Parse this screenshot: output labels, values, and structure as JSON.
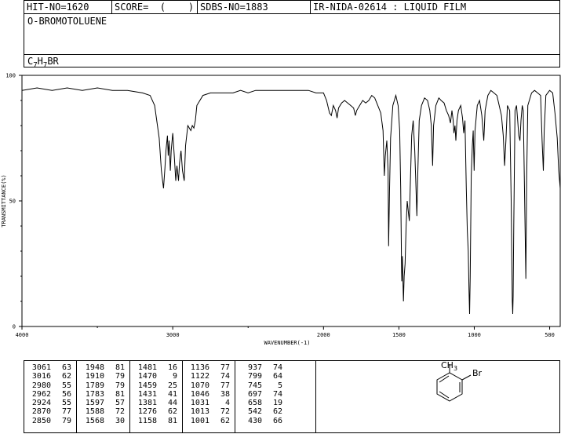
{
  "header": {
    "hit_no": "HIT-NO=1620",
    "score": "SCORE=  (    )",
    "sdbs_no": "SDBS-NO=1883",
    "ir_nida": "IR-NIDA-02614 : LIQUID FILM",
    "compound": "O-BROMOTOLUENE",
    "formula_c": "C",
    "formula_c_sub": "7",
    "formula_h": "H",
    "formula_h_sub": "7",
    "formula_br": "BR"
  },
  "chart_data": {
    "type": "line",
    "xlabel": "WAVENUMBER(-1)",
    "ylabel": "TRANSMITTANCE(%)",
    "xlim": [
      4000,
      430
    ],
    "ylim": [
      0,
      100
    ],
    "x_reversed": true,
    "x_ticks": [
      4000,
      3000,
      2000,
      1500,
      1000,
      500
    ],
    "y_ticks": [
      100,
      50,
      0
    ],
    "minor_x_ticks": [
      3500,
      2500,
      1000,
      500
    ],
    "grid": false,
    "series": [
      {
        "points": [
          [
            4000,
            94
          ],
          [
            3900,
            95
          ],
          [
            3800,
            94
          ],
          [
            3700,
            95
          ],
          [
            3600,
            94
          ],
          [
            3500,
            95
          ],
          [
            3400,
            94
          ],
          [
            3300,
            94
          ],
          [
            3200,
            93
          ],
          [
            3150,
            92
          ],
          [
            3120,
            88
          ],
          [
            3090,
            75
          ],
          [
            3075,
            62
          ],
          [
            3061,
            55
          ],
          [
            3052,
            63
          ],
          [
            3045,
            70
          ],
          [
            3035,
            76
          ],
          [
            3030,
            68
          ],
          [
            3024,
            74
          ],
          [
            3016,
            62
          ],
          [
            3010,
            70
          ],
          [
            3000,
            77
          ],
          [
            2990,
            68
          ],
          [
            2980,
            58
          ],
          [
            2972,
            64
          ],
          [
            2962,
            58
          ],
          [
            2955,
            65
          ],
          [
            2945,
            70
          ],
          [
            2935,
            62
          ],
          [
            2924,
            58
          ],
          [
            2915,
            72
          ],
          [
            2900,
            80
          ],
          [
            2880,
            78
          ],
          [
            2870,
            80
          ],
          [
            2860,
            79
          ],
          [
            2850,
            82
          ],
          [
            2840,
            88
          ],
          [
            2800,
            92
          ],
          [
            2750,
            93
          ],
          [
            2700,
            93
          ],
          [
            2650,
            93
          ],
          [
            2600,
            93
          ],
          [
            2550,
            94
          ],
          [
            2500,
            93
          ],
          [
            2450,
            94
          ],
          [
            2400,
            94
          ],
          [
            2350,
            94
          ],
          [
            2300,
            94
          ],
          [
            2250,
            94
          ],
          [
            2200,
            94
          ],
          [
            2150,
            94
          ],
          [
            2100,
            94
          ],
          [
            2050,
            93
          ],
          [
            2000,
            93
          ],
          [
            1980,
            90
          ],
          [
            1960,
            85
          ],
          [
            1948,
            84
          ],
          [
            1935,
            88
          ],
          [
            1920,
            86
          ],
          [
            1910,
            83
          ],
          [
            1900,
            87
          ],
          [
            1880,
            89
          ],
          [
            1860,
            90
          ],
          [
            1840,
            89
          ],
          [
            1820,
            88
          ],
          [
            1800,
            87
          ],
          [
            1789,
            84
          ],
          [
            1780,
            86
          ],
          [
            1770,
            87
          ],
          [
            1760,
            88
          ],
          [
            1740,
            90
          ],
          [
            1720,
            89
          ],
          [
            1700,
            90
          ],
          [
            1680,
            92
          ],
          [
            1660,
            91
          ],
          [
            1640,
            88
          ],
          [
            1620,
            85
          ],
          [
            1605,
            78
          ],
          [
            1597,
            60
          ],
          [
            1590,
            68
          ],
          [
            1580,
            74
          ],
          [
            1572,
            62
          ],
          [
            1568,
            32
          ],
          [
            1562,
            55
          ],
          [
            1555,
            75
          ],
          [
            1540,
            88
          ],
          [
            1520,
            92
          ],
          [
            1505,
            88
          ],
          [
            1495,
            78
          ],
          [
            1488,
            55
          ],
          [
            1481,
            18
          ],
          [
            1477,
            28
          ],
          [
            1470,
            10
          ],
          [
            1465,
            20
          ],
          [
            1459,
            25
          ],
          [
            1452,
            40
          ],
          [
            1445,
            50
          ],
          [
            1438,
            46
          ],
          [
            1431,
            42
          ],
          [
            1425,
            55
          ],
          [
            1415,
            76
          ],
          [
            1405,
            82
          ],
          [
            1395,
            70
          ],
          [
            1388,
            58
          ],
          [
            1381,
            44
          ],
          [
            1375,
            60
          ],
          [
            1365,
            82
          ],
          [
            1350,
            88
          ],
          [
            1330,
            91
          ],
          [
            1310,
            90
          ],
          [
            1295,
            86
          ],
          [
            1285,
            80
          ],
          [
            1276,
            64
          ],
          [
            1270,
            80
          ],
          [
            1255,
            88
          ],
          [
            1235,
            91
          ],
          [
            1220,
            90
          ],
          [
            1200,
            89
          ],
          [
            1185,
            86
          ],
          [
            1170,
            84
          ],
          [
            1158,
            81
          ],
          [
            1148,
            86
          ],
          [
            1140,
            82
          ],
          [
            1135,
            77
          ],
          [
            1128,
            80
          ],
          [
            1122,
            74
          ],
          [
            1115,
            82
          ],
          [
            1105,
            86
          ],
          [
            1090,
            88
          ],
          [
            1078,
            83
          ],
          [
            1070,
            77
          ],
          [
            1062,
            82
          ],
          [
            1053,
            55
          ],
          [
            1046,
            38
          ],
          [
            1040,
            30
          ],
          [
            1035,
            15
          ],
          [
            1031,
            5
          ],
          [
            1027,
            20
          ],
          [
            1020,
            60
          ],
          [
            1013,
            72
          ],
          [
            1007,
            78
          ],
          [
            1001,
            62
          ],
          [
            995,
            78
          ],
          [
            980,
            88
          ],
          [
            965,
            90
          ],
          [
            950,
            84
          ],
          [
            937,
            74
          ],
          [
            928,
            86
          ],
          [
            910,
            92
          ],
          [
            890,
            94
          ],
          [
            870,
            93
          ],
          [
            850,
            92
          ],
          [
            835,
            88
          ],
          [
            820,
            84
          ],
          [
            808,
            76
          ],
          [
            799,
            64
          ],
          [
            790,
            74
          ],
          [
            780,
            88
          ],
          [
            765,
            86
          ],
          [
            755,
            50
          ],
          [
            748,
            10
          ],
          [
            745,
            5
          ],
          [
            742,
            12
          ],
          [
            738,
            40
          ],
          [
            730,
            86
          ],
          [
            720,
            88
          ],
          [
            712,
            82
          ],
          [
            705,
            76
          ],
          [
            697,
            74
          ],
          [
            690,
            82
          ],
          [
            682,
            88
          ],
          [
            675,
            86
          ],
          [
            668,
            58
          ],
          [
            658,
            19
          ],
          [
            652,
            60
          ],
          [
            645,
            88
          ],
          [
            620,
            93
          ],
          [
            600,
            94
          ],
          [
            580,
            93
          ],
          [
            560,
            92
          ],
          [
            550,
            74
          ],
          [
            542,
            62
          ],
          [
            536,
            78
          ],
          [
            525,
            92
          ],
          [
            500,
            94
          ],
          [
            480,
            93
          ],
          [
            465,
            85
          ],
          [
            450,
            75
          ],
          [
            440,
            62
          ],
          [
            430,
            55
          ]
        ]
      }
    ]
  },
  "peaks": [
    [
      "3061",
      "63"
    ],
    [
      "3016",
      "62"
    ],
    [
      "2980",
      "55"
    ],
    [
      "2962",
      "56"
    ],
    [
      "2924",
      "55"
    ],
    [
      "2870",
      "77"
    ],
    [
      "2850",
      "79"
    ],
    [
      "1948",
      "81"
    ],
    [
      "1910",
      "79"
    ],
    [
      "1789",
      "79"
    ],
    [
      "1783",
      "81"
    ],
    [
      "1597",
      "57"
    ],
    [
      "1588",
      "72"
    ],
    [
      "1568",
      "30"
    ],
    [
      "1481",
      "16"
    ],
    [
      "1470",
      "9"
    ],
    [
      "1459",
      "25"
    ],
    [
      "1431",
      "41"
    ],
    [
      "1381",
      "44"
    ],
    [
      "1276",
      "62"
    ],
    [
      "1158",
      "81"
    ],
    [
      "1136",
      "77"
    ],
    [
      "1122",
      "74"
    ],
    [
      "1070",
      "77"
    ],
    [
      "1046",
      "38"
    ],
    [
      "1031",
      "4"
    ],
    [
      "1013",
      "72"
    ],
    [
      "1001",
      "62"
    ],
    [
      "937",
      "74"
    ],
    [
      "799",
      "64"
    ],
    [
      "745",
      "5"
    ],
    [
      "697",
      "74"
    ],
    [
      "658",
      "19"
    ],
    [
      "542",
      "62"
    ],
    [
      "430",
      "66"
    ]
  ],
  "structure": {
    "methyl_label": "CH",
    "methyl_sub": "3",
    "bromo_label": "Br"
  }
}
